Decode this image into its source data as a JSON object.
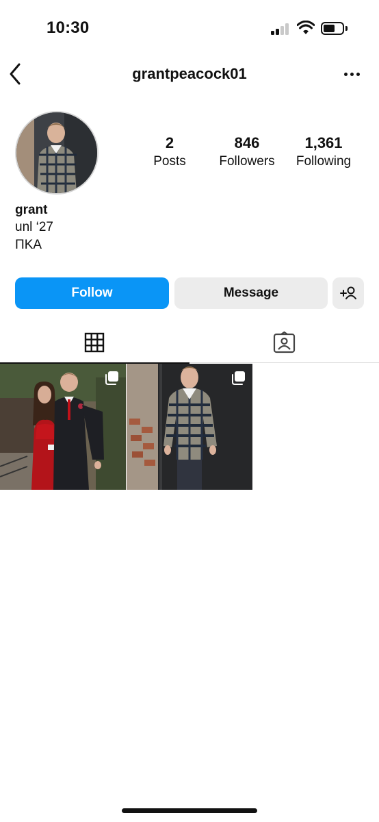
{
  "status_bar": {
    "time": "10:30",
    "battery_level": 0.6
  },
  "nav": {
    "username": "grantpeacock01",
    "back_icon": "chevron-left-icon",
    "more_icon": "more-horizontal-icon"
  },
  "profile": {
    "stats": [
      {
        "value": "2",
        "label": "Posts"
      },
      {
        "value": "846",
        "label": "Followers"
      },
      {
        "value": "1,361",
        "label": "Following"
      }
    ],
    "name": "grant",
    "bio_lines": [
      "unl ‘27",
      "ΠΚA"
    ]
  },
  "actions": {
    "follow_label": "Follow",
    "message_label": "Message",
    "add_user_icon": "add-person-icon",
    "follow_color": "#0a95f6"
  },
  "tabs": [
    {
      "name": "posts-grid",
      "icon": "grid-icon",
      "active": true
    },
    {
      "name": "tagged",
      "icon": "tagged-user-icon",
      "active": false
    }
  ],
  "posts": [
    {
      "description_icon": "multi-photo-icon"
    },
    {
      "description_icon": "multi-photo-icon"
    }
  ]
}
